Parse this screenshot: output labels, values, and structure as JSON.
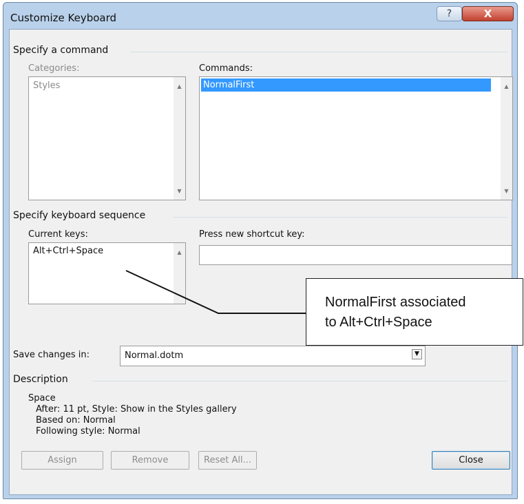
{
  "window": {
    "title": "Customize Keyboard",
    "help_glyph": "?",
    "close_glyph": "X"
  },
  "specify_command": {
    "group_label": "Specify a command",
    "categories_label": "Categories:",
    "categories": [
      "Styles"
    ],
    "commands_label": "Commands:",
    "commands": [
      "NormalFirst"
    ],
    "selected_command": "NormalFirst"
  },
  "keyboard_sequence": {
    "group_label": "Specify keyboard sequence",
    "current_keys_label": "Current keys:",
    "current_keys": [
      "Alt+Ctrl+Space"
    ],
    "new_shortcut_label": "Press new shortcut key:",
    "new_shortcut_value": ""
  },
  "save_changes": {
    "label": "Save changes in:",
    "value": "Normal.dotm"
  },
  "description": {
    "group_label": "Description",
    "lines": [
      "Space",
      "After:  11 pt, Style: Show in the Styles gallery",
      "Based on: Normal",
      "Following style: Normal"
    ]
  },
  "buttons": {
    "assign": "Assign",
    "remove": "Remove",
    "reset_all": "Reset All...",
    "close": "Close"
  },
  "annotation": {
    "lines": [
      "NormalFirst associated",
      "to Alt+Ctrl+Space"
    ]
  },
  "icons": {
    "scroll_up": "▲",
    "scroll_down": "▼",
    "dropdown": "▼"
  },
  "colors": {
    "selection": "#3399ff",
    "title_close_button": "#c2412f",
    "window_frame": "#b9d1ea"
  }
}
